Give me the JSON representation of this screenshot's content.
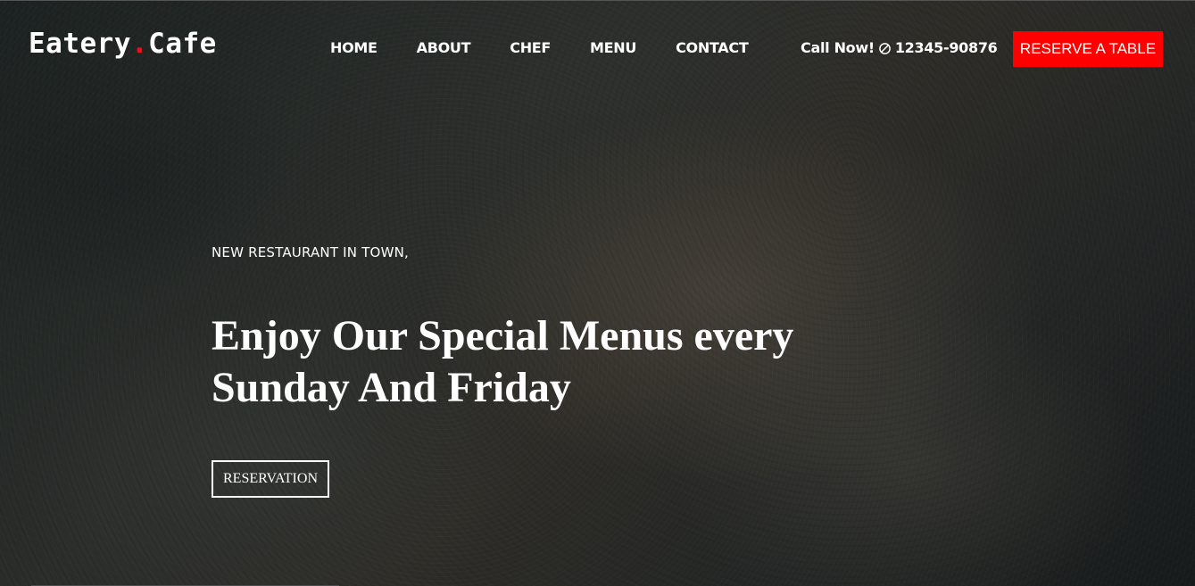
{
  "header": {
    "logo_text": "Eatery",
    "logo_dot": ".",
    "logo_suffix": "Cafe",
    "nav": [
      {
        "label": "HOME"
      },
      {
        "label": "ABOUT"
      },
      {
        "label": "CHEF"
      },
      {
        "label": "MENU"
      },
      {
        "label": "CONTACT"
      }
    ],
    "call_label": "Call Now!",
    "phone_icon": "phone-icon",
    "phone_number": "12345-90876",
    "reserve_button": "RESERVE A TABLE"
  },
  "hero": {
    "kicker": "NEW RESTAURANT IN TOWN,",
    "headline": "Enjoy Our Special Menus every Sunday And Friday",
    "cta_label": "RESERVATION"
  },
  "colors": {
    "accent": "#ff0000",
    "logo_dot": "#e8141b",
    "text": "#ffffff",
    "background": "#1f2322"
  }
}
